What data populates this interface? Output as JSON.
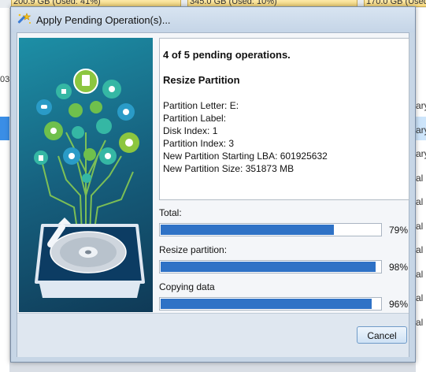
{
  "background": {
    "top_cells": [
      "200.9 GB (Used: 41%)",
      "345.0 GB (Used: 10%)",
      "170.0 GB (Used"
    ],
    "left_number": "03",
    "right_fragments": [
      "ary",
      "ary",
      "ary",
      "al",
      "al",
      "al",
      "al",
      "al",
      "al",
      "al"
    ]
  },
  "dialog": {
    "title": "Apply Pending Operation(s)...",
    "header": "4 of 5 pending operations.",
    "operation_title": "Resize Partition",
    "details": [
      "Partition Letter: E:",
      "Partition Label:",
      "Disk Index: 1",
      "Partition Index: 3",
      "New Partition Starting LBA: 601925632",
      "New Partition Size: 351873 MB"
    ],
    "progress": [
      {
        "label": "Total:",
        "value": 79,
        "text": "79%"
      },
      {
        "label": "Resize partition:",
        "value": 98,
        "text": "98%"
      },
      {
        "label": "Copying data",
        "value": 96,
        "text": "96%"
      }
    ],
    "cancel_label": "Cancel"
  },
  "colors": {
    "progress_fill": "#2f72c6",
    "art_gradient_top": "#1d8fa6",
    "art_gradient_bottom": "#0f3a57"
  }
}
